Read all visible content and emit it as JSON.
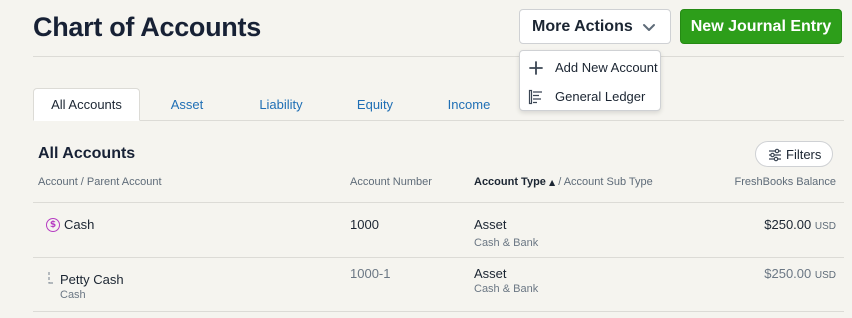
{
  "header": {
    "title": "Chart of Accounts",
    "more_actions_label": "More Actions",
    "new_journal_label": "New Journal Entry"
  },
  "dropdown": {
    "items": [
      {
        "label": "Add New Account",
        "icon": "plus-icon"
      },
      {
        "label": "General Ledger",
        "icon": "ledger-icon"
      }
    ]
  },
  "tabs": [
    {
      "label": "All Accounts",
      "active": true
    },
    {
      "label": "Asset",
      "active": false
    },
    {
      "label": "Liability",
      "active": false
    },
    {
      "label": "Equity",
      "active": false
    },
    {
      "label": "Income",
      "active": false
    }
  ],
  "section": {
    "title": "All Accounts",
    "filters_label": "Filters"
  },
  "columns": {
    "account": "Account / Parent Account",
    "number": "Account Number",
    "type_bold": "Account Type",
    "type_sort": "▲",
    "type_rest": " / Account Sub Type",
    "balance": "FreshBooks Balance"
  },
  "rows": [
    {
      "name": "Cash",
      "parent": "",
      "number": "1000",
      "type": "Asset",
      "subtype": "Cash & Bank",
      "balance": "$250.00",
      "currency": "USD",
      "icon": "dollar-circle-icon"
    },
    {
      "name": "Petty Cash",
      "parent": "Cash",
      "number": "1000-1",
      "type": "Asset",
      "subtype": "Cash & Bank",
      "balance": "$250.00",
      "currency": "USD",
      "icon": "child-account-icon"
    }
  ],
  "colors": {
    "primary_green": "#2d9e1a",
    "tab_link": "#1f6fb5",
    "cash_icon": "#b63cc2"
  }
}
